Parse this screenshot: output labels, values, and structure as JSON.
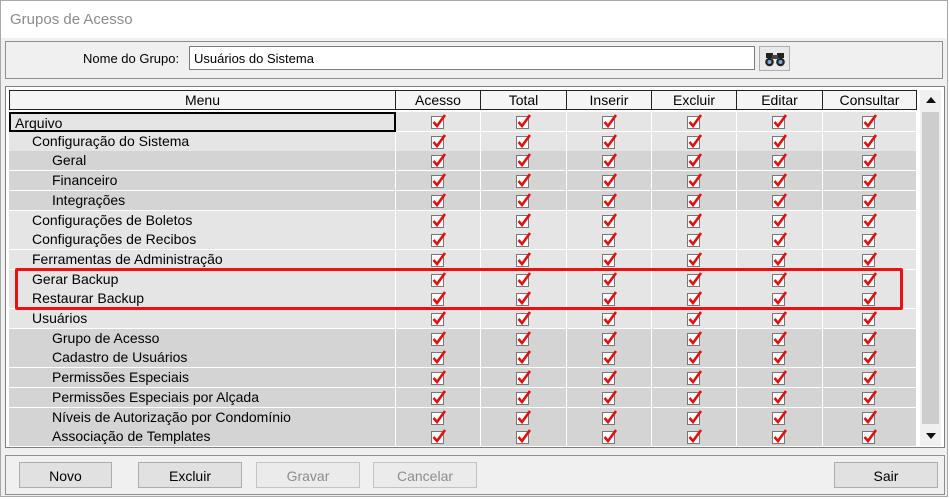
{
  "window": {
    "title": "Grupos de Acesso"
  },
  "filter": {
    "label": "Nome do Grupo:",
    "value": "Usuários do Sistema",
    "search_icon": "binoculars-icon"
  },
  "grid": {
    "columns": [
      "Menu",
      "Acesso",
      "Total",
      "Inserir",
      "Excluir",
      "Editar",
      "Consultar"
    ],
    "rows": [
      {
        "label": "Arquivo",
        "level": 0,
        "checks": [
          true,
          true,
          true,
          true,
          true,
          true
        ]
      },
      {
        "label": "Configuração do Sistema",
        "level": 1,
        "checks": [
          true,
          true,
          true,
          true,
          true,
          true
        ]
      },
      {
        "label": "Geral",
        "level": 2,
        "checks": [
          true,
          true,
          true,
          true,
          true,
          true
        ]
      },
      {
        "label": "Financeiro",
        "level": 2,
        "checks": [
          true,
          true,
          true,
          true,
          true,
          true
        ]
      },
      {
        "label": "Integrações",
        "level": 2,
        "checks": [
          true,
          true,
          true,
          true,
          true,
          true
        ]
      },
      {
        "label": "Configurações de Boletos",
        "level": 1,
        "checks": [
          true,
          true,
          true,
          true,
          true,
          true
        ]
      },
      {
        "label": "Configurações de Recibos",
        "level": 1,
        "checks": [
          true,
          true,
          true,
          true,
          true,
          true
        ]
      },
      {
        "label": "Ferramentas de Administração",
        "level": 1,
        "checks": [
          true,
          true,
          true,
          true,
          true,
          true
        ]
      },
      {
        "label": "Gerar Backup",
        "level": 1,
        "checks": [
          true,
          true,
          true,
          true,
          true,
          true
        ]
      },
      {
        "label": "Restaurar Backup",
        "level": 1,
        "checks": [
          true,
          true,
          true,
          true,
          true,
          true
        ]
      },
      {
        "label": "Usuários",
        "level": 1,
        "checks": [
          true,
          true,
          true,
          true,
          true,
          true
        ]
      },
      {
        "label": "Grupo de Acesso",
        "level": 2,
        "checks": [
          true,
          true,
          true,
          true,
          true,
          true
        ]
      },
      {
        "label": "Cadastro de Usuários",
        "level": 2,
        "checks": [
          true,
          true,
          true,
          true,
          true,
          true
        ]
      },
      {
        "label": "Permissões Especiais",
        "level": 2,
        "checks": [
          true,
          true,
          true,
          true,
          true,
          true
        ]
      },
      {
        "label": "Permissões Especiais por Alçada",
        "level": 2,
        "checks": [
          true,
          true,
          true,
          true,
          true,
          true
        ]
      },
      {
        "label": "Níveis de Autorização por Condomínio",
        "level": 2,
        "checks": [
          true,
          true,
          true,
          true,
          true,
          true
        ]
      },
      {
        "label": "Associação de Templates",
        "level": 2,
        "checks": [
          true,
          true,
          true,
          true,
          true,
          true
        ]
      }
    ],
    "selected_row": 0,
    "highlighted_rows": [
      8,
      9
    ]
  },
  "buttons": {
    "novo": "Novo",
    "excluir": "Excluir",
    "gravar": "Gravar",
    "cancelar": "Cancelar",
    "sair": "Sair"
  },
  "colors": {
    "check_red": "#e01010",
    "highlight": "#ee1010",
    "row_light": "#e5e5e5",
    "row_dark": "#d4d4d4"
  }
}
